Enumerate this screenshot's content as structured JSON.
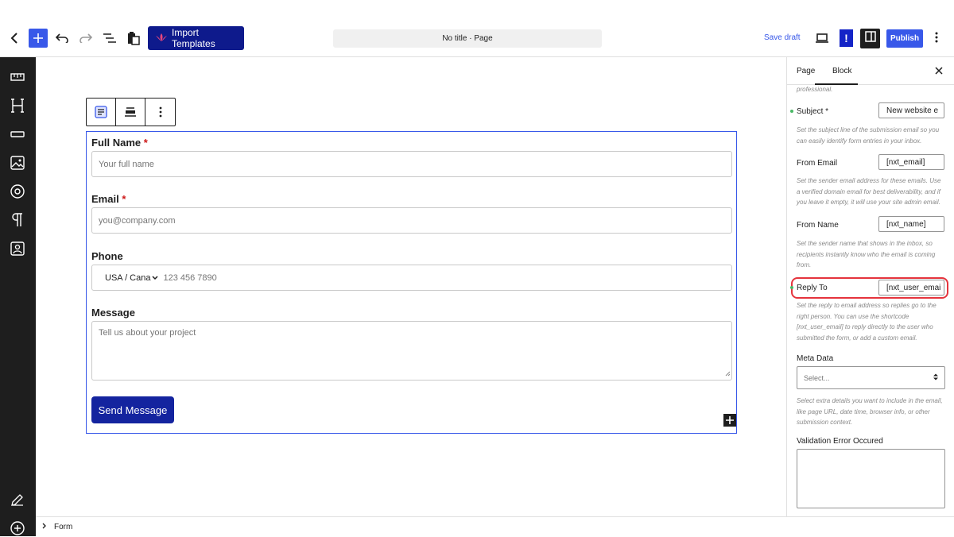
{
  "toolbar": {
    "import_label": "Import Templates",
    "page_title": "No title · Page",
    "save_draft": "Save draft",
    "publish": "Publish",
    "excl": "!"
  },
  "form": {
    "full_name_label": "Full Name",
    "full_name_placeholder": "Your full name",
    "email_label": "Email",
    "email_placeholder": "you@company.com",
    "phone_label": "Phone",
    "phone_country": "USA / Cana",
    "phone_placeholder": "123 456 7890",
    "message_label": "Message",
    "message_placeholder": "Tell us about your project",
    "required_mark": "*",
    "submit_label": "Send Message"
  },
  "footer": {
    "breadcrumb": "Form"
  },
  "panel": {
    "tabs": [
      {
        "label": "Page"
      },
      {
        "label": "Block"
      }
    ],
    "truncated_help": "professional.",
    "subject_label": "Subject *",
    "subject_value": "New website e",
    "subject_help": "Set the subject line of the submission email so you can easily identify form entries in your inbox.",
    "from_email_label": "From Email",
    "from_email_value": "[nxt_email]",
    "from_email_help": "Set the sender email address for these emails. Use a verified domain email for best deliverability, and if you leave it empty, it will use your site admin email.",
    "from_name_label": "From Name",
    "from_name_value": "[nxt_name]",
    "from_name_help": "Set the sender name that shows in the inbox, so recipients instantly know who the email is coming from.",
    "reply_to_label": "Reply To",
    "reply_to_value": "[nxt_user_emai",
    "reply_to_help": "Set the reply to email address so replies go to the right person. You can use the shortcode [nxt_user_email] to reply directly to the user who submitted the form, or add a custom email.",
    "meta_data_label": "Meta Data",
    "meta_data_placeholder": "Select...",
    "meta_data_help": "Select extra details you want to include in the email, like page URL, date time, browser info, or other submission context.",
    "validation_label": "Validation Error Occured"
  },
  "colors": {
    "accent": "#3858e9",
    "import_bg": "#0e1a8c",
    "submit_bg": "#14249f",
    "highlight": "#e5343d"
  },
  "icons": [
    "back-icon",
    "add-icon",
    "undo-icon",
    "redo-icon",
    "list-view-icon",
    "clipboard-icon",
    "preview-icon",
    "sidebar-icon",
    "more-vertical-icon",
    "close-icon"
  ]
}
